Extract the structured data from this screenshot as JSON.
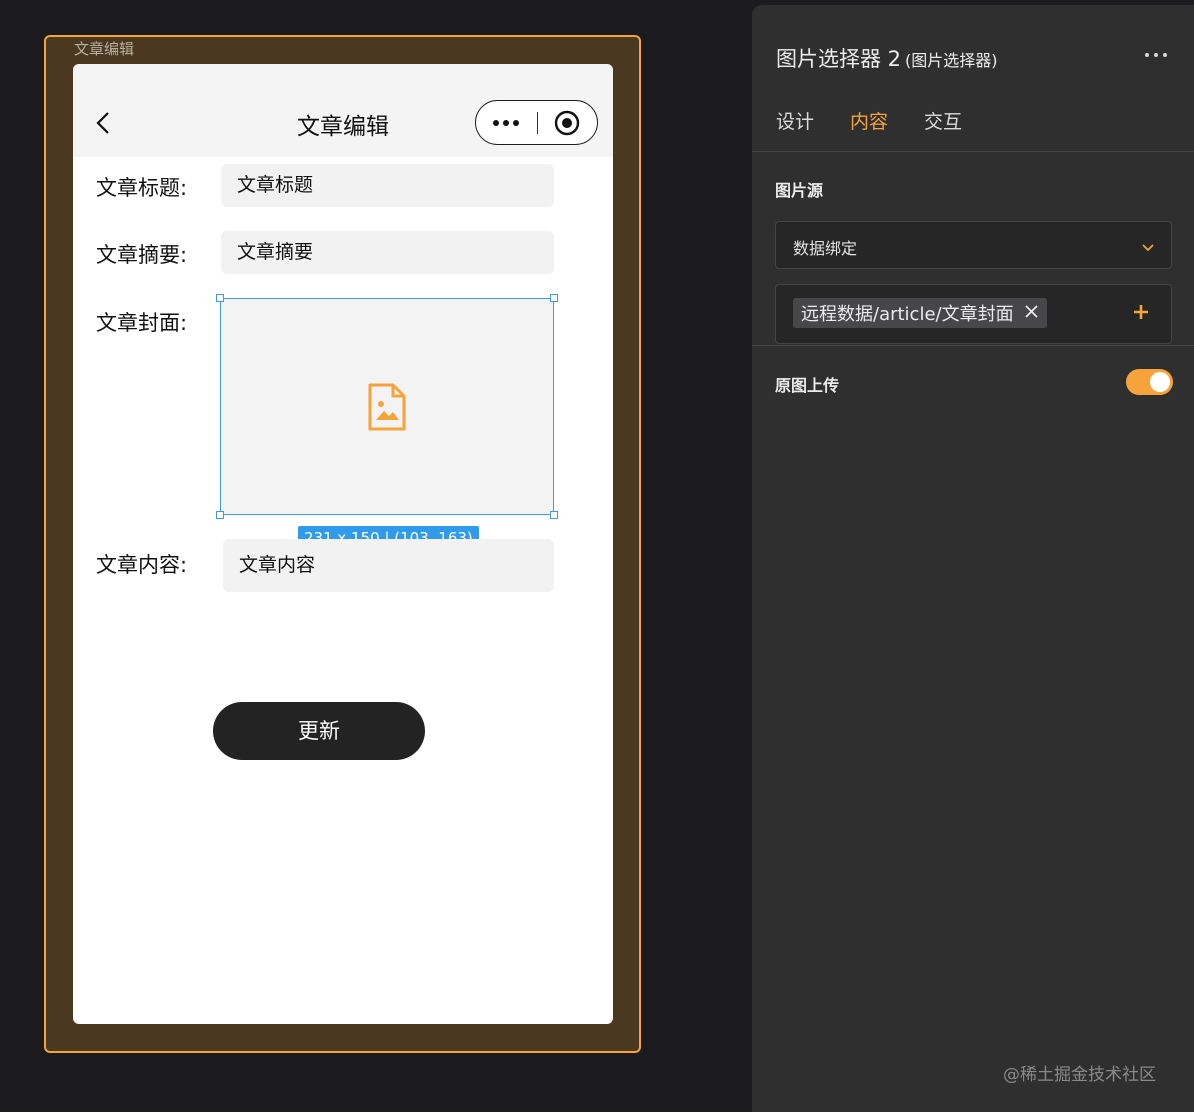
{
  "canvas": {
    "label": "文章编辑"
  },
  "phone": {
    "nav": {
      "title": "文章编辑"
    },
    "form": {
      "title_label": "文章标题:",
      "title_value": "文章标题",
      "summary_label": "文章摘要:",
      "summary_value": "文章摘要",
      "cover_label": "文章封面:",
      "content_label": "文章内容:",
      "content_value": "文章内容"
    },
    "selection_badge": "231 x 150 | (103, 163)",
    "update_button": "更新"
  },
  "panel": {
    "title": "图片选择器 2",
    "subtitle": "(图片选择器)",
    "tabs": [
      {
        "label": "设计",
        "active": false
      },
      {
        "label": "内容",
        "active": true
      },
      {
        "label": "交互",
        "active": false
      }
    ],
    "image_source_label": "图片源",
    "binding_mode": "数据绑定",
    "binding_tag": "远程数据/article/文章封面",
    "original_upload_label": "原图上传",
    "original_upload_on": true
  },
  "watermark": "@稀土掘金技术社区",
  "colors": {
    "accent": "#f5a33a",
    "selection": "#3d9be8",
    "panel_bg": "#2f2f30"
  }
}
